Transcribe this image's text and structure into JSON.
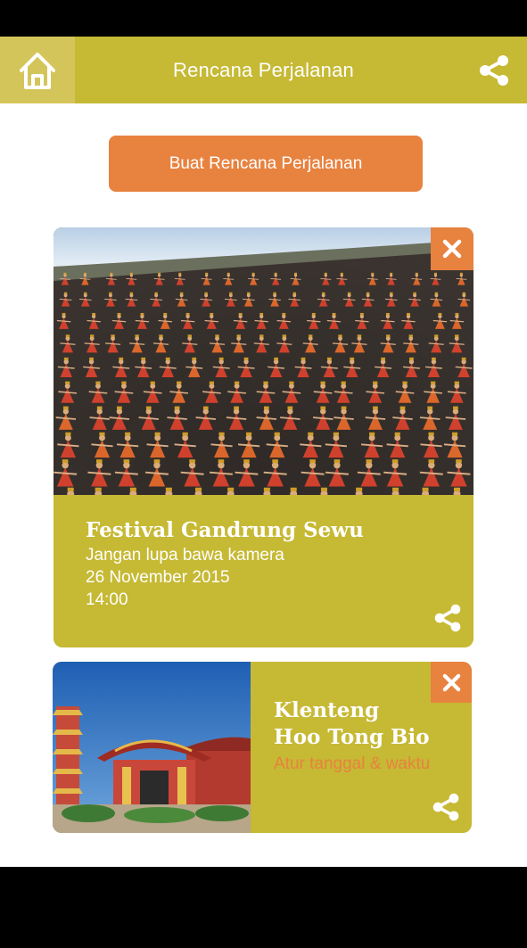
{
  "header": {
    "title": "Rencana Perjalanan",
    "home_icon": "home-icon",
    "share_icon": "share-icon"
  },
  "actions": {
    "create_plan_label": "Buat Rencana Perjalanan"
  },
  "plans": [
    {
      "title": "Festival Gandrung Sewu",
      "note": "Jangan lupa bawa kamera",
      "date": "26 November 2015",
      "time": "14:00",
      "photo": "festival-dancers-photo",
      "close_icon": "close-icon",
      "share_icon": "share-icon"
    },
    {
      "title_line1": "Klenteng",
      "title_line2": "Hoo Tong Bio",
      "set_datetime": "Atur tanggal & waktu",
      "photo": "temple-photo",
      "close_icon": "close-icon",
      "share_icon": "share-icon"
    }
  ],
  "colors": {
    "header": "#c6b934",
    "home_button": "#d4c55a",
    "accent": "#e8823f",
    "card": "#c6b934",
    "text_light": "#ffffff"
  }
}
